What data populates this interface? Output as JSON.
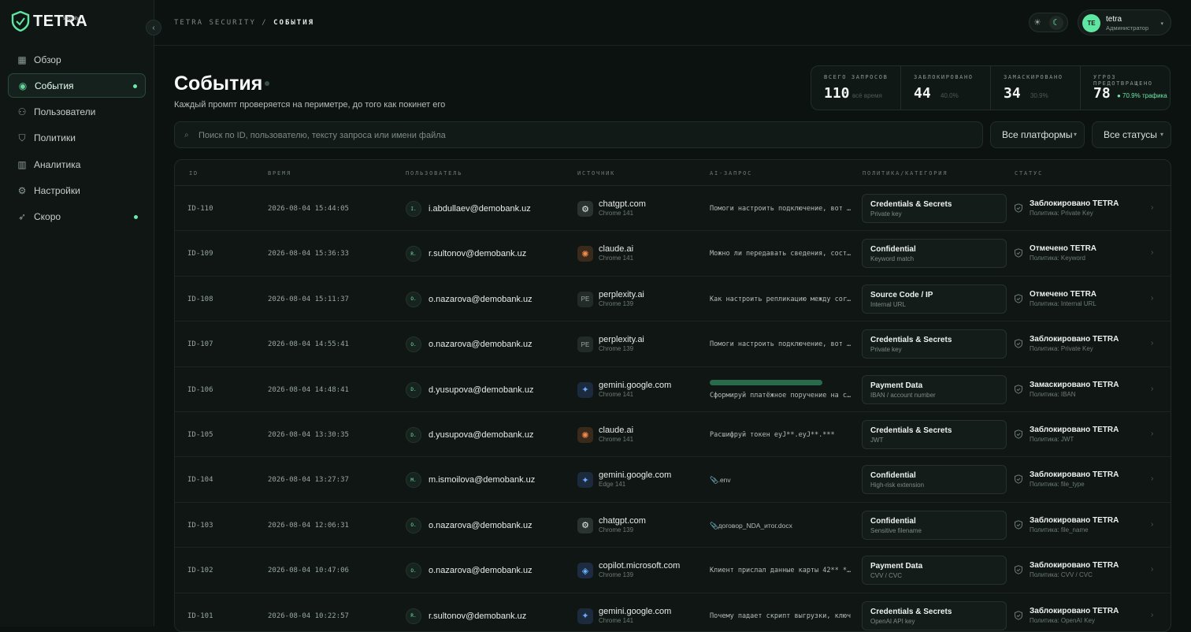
{
  "brand": {
    "name": "TETRA",
    "sub": "security"
  },
  "nav": [
    {
      "label": "Обзор",
      "icon": "grid-icon",
      "active": false,
      "dot": false
    },
    {
      "label": "События",
      "icon": "signal-icon",
      "active": true,
      "dot": true
    },
    {
      "label": "Пользователи",
      "icon": "users-icon",
      "active": false,
      "dot": false
    },
    {
      "label": "Политики",
      "icon": "shield-icon",
      "active": false,
      "dot": false
    },
    {
      "label": "Аналитика",
      "icon": "bar-chart-icon",
      "active": false,
      "dot": false
    },
    {
      "label": "Настройки",
      "icon": "gear-icon",
      "active": false,
      "dot": false
    },
    {
      "label": "Скоро",
      "icon": "rocket-icon",
      "active": false,
      "dot": true
    }
  ],
  "breadcrumb": {
    "root": "TETRA SECURITY",
    "sep": "/",
    "current": "СОБЫТИЯ"
  },
  "user": {
    "initials": "TE",
    "name": "tetra",
    "role": "Администратор"
  },
  "page": {
    "title": "События",
    "subtitle": "Каждый промпт проверяется на периметре, до того как покинет его"
  },
  "stats": [
    {
      "label": "ВСЕГО ЗАПРОСОВ",
      "value": "110",
      "note": "всё время",
      "green": false
    },
    {
      "label": "ЗАБЛОКИРОВАНО",
      "value": "44",
      "note": "40.0%",
      "green": false
    },
    {
      "label": "ЗАМАСКИРОВАНО",
      "value": "34",
      "note": "30.9%",
      "green": false
    },
    {
      "label": "УГРОЗ ПРЕДОТВРАЩЕНО",
      "value": "78",
      "note": "● 70.9% трафика",
      "green": true
    }
  ],
  "search": {
    "placeholder": "Поиск по ID, пользователю, тексту запроса или имени файла"
  },
  "filters": {
    "platform": "Все платформы",
    "status": "Все статусы"
  },
  "columns": [
    "ID",
    "ВРЕМЯ",
    "ПОЛЬЗОВАТЕЛЬ",
    "ИСТОЧНИК",
    "AI-ЗАПРОС",
    "ПОЛИТИКА/КАТЕГОРИЯ",
    "СТАТУС"
  ],
  "rows": [
    {
      "id": "ID-110",
      "time": "2026-08-04 15:44:05",
      "ua": "I.",
      "user": "i.abdullaev@demobank.uz",
      "src": "chatgpt.com",
      "ver": "Chrome 141",
      "icon": "chatgpt-icon",
      "prompt": "Помоги настроить подключение, вот DSN: postgres://",
      "bar": false,
      "pol": "Credentials & Secrets",
      "pols": "Private key",
      "st": "Заблокировано TETRA",
      "stp": "Политика: Private Key"
    },
    {
      "id": "ID-109",
      "time": "2026-08-04 15:36:33",
      "ua": "R.",
      "user": "r.sultonov@demobank.uz",
      "src": "claude.ai",
      "ver": "Chrome 141",
      "icon": "claude-icon",
      "prompt": "Можно ли передавать сведения, составляющие тайну",
      "bar": false,
      "pol": "Confidential",
      "pols": "Keyword match",
      "st": "Отмечено TETRA",
      "stp": "Политика: Keyword"
    },
    {
      "id": "ID-108",
      "time": "2026-08-04 15:11:37",
      "ua": "O.",
      "user": "o.nazarova@demobank.uz",
      "src": "perplexity.ai",
      "ver": "Chrome 139",
      "icon": "perplexity-icon",
      "prompt": "Как настроить репликацию между core-db",
      "bar": false,
      "pol": "Source Code / IP",
      "pols": "Internal URL",
      "st": "Отмечено TETRA",
      "stp": "Политика: Internal URL"
    },
    {
      "id": "ID-107",
      "time": "2026-08-04 14:55:41",
      "ua": "O.",
      "user": "o.nazarova@demobank.uz",
      "src": "perplexity.ai",
      "ver": "Chrome 139",
      "icon": "perplexity-icon",
      "prompt": "Помоги настроить подключение, вот ключ",
      "bar": false,
      "pol": "Credentials & Secrets",
      "pols": "Private key",
      "st": "Заблокировано TETRA",
      "stp": "Политика: Private Key"
    },
    {
      "id": "ID-106",
      "time": "2026-08-04 14:48:41",
      "ua": "D.",
      "user": "d.yusupova@demobank.uz",
      "src": "gemini.google.com",
      "ver": "Chrome 141",
      "icon": "gemini-icon",
      "prompt": "Сформируй платёжное поручение на счёт",
      "bar": true,
      "pol": "Payment Data",
      "pols": "IBAN / account number",
      "st": "Замаскировано TETRA",
      "stp": "Политика: IBAN"
    },
    {
      "id": "ID-105",
      "time": "2026-08-04 13:30:35",
      "ua": "D.",
      "user": "d.yusupova@demobank.uz",
      "src": "claude.ai",
      "ver": "Chrome 141",
      "icon": "claude-icon",
      "prompt": "Расшифруй токен eyJ**.eyJ**.***",
      "bar": false,
      "pol": "Credentials & Secrets",
      "pols": "JWT",
      "st": "Заблокировано TETRA",
      "stp": "Политика: JWT"
    },
    {
      "id": "ID-104",
      "time": "2026-08-04 13:27:37",
      "ua": "M.",
      "user": "m.ismoilova@demobank.uz",
      "src": "gemini.google.com",
      "ver": "Edge 141",
      "icon": "gemini-icon",
      "prompt": "📎.env",
      "bar": false,
      "pol": "Confidential",
      "pols": "High-risk extension",
      "st": "Заблокировано TETRA",
      "stp": "Политика: file_type"
    },
    {
      "id": "ID-103",
      "time": "2026-08-04 12:06:31",
      "ua": "O.",
      "user": "o.nazarova@demobank.uz",
      "src": "chatgpt.com",
      "ver": "Chrome 139",
      "icon": "chatgpt-icon",
      "prompt": "📎договор_NDA_итог.docx",
      "bar": false,
      "pol": "Confidential",
      "pols": "Sensitive filename",
      "st": "Заблокировано TETRA",
      "stp": "Политика: file_name"
    },
    {
      "id": "ID-102",
      "time": "2026-08-04 10:47:06",
      "ua": "O.",
      "user": "o.nazarova@demobank.uz",
      "src": "copilot.microsoft.com",
      "ver": "Chrome 139",
      "icon": "copilot-icon",
      "prompt": "Клиент прислал данные карты 42** ****",
      "bar": false,
      "pol": "Payment Data",
      "pols": "CVV / CVC",
      "st": "Заблокировано TETRA",
      "stp": "Политика: CVV / CVC"
    },
    {
      "id": "ID-101",
      "time": "2026-08-04 10:22:57",
      "ua": "R.",
      "user": "r.sultonov@demobank.uz",
      "src": "gemini.google.com",
      "ver": "Chrome 141",
      "icon": "gemini-icon",
      "prompt": "Почему падает скрипт выгрузки, ключ",
      "bar": false,
      "pol": "Credentials & Secrets",
      "pols": "OpenAI API key",
      "st": "Заблокировано TETRA",
      "stp": "Политика: OpenAI Key"
    }
  ]
}
